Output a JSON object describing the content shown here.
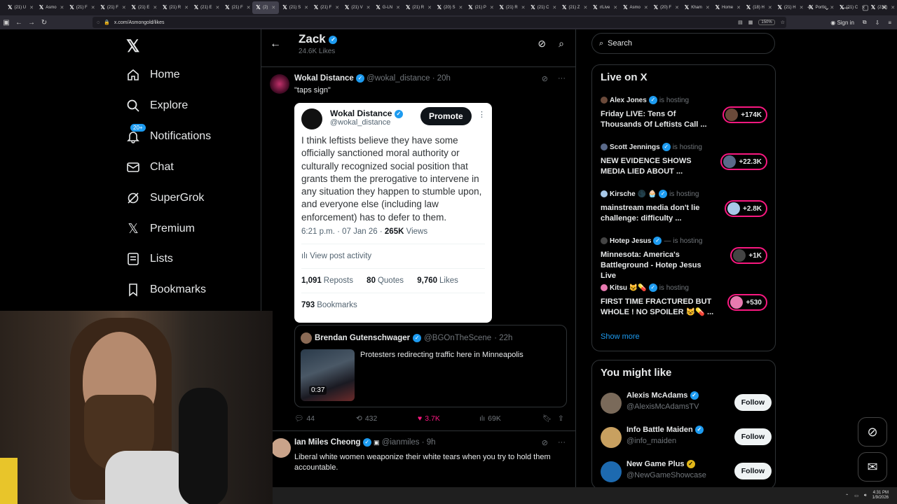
{
  "browser": {
    "tabs": [
      {
        "label": "(21) U",
        "active": false
      },
      {
        "label": "Asmo",
        "active": false
      },
      {
        "label": "(21) F",
        "active": false
      },
      {
        "label": "(21) F",
        "active": false
      },
      {
        "label": "(21) E",
        "active": false
      },
      {
        "label": "(21) R",
        "active": false
      },
      {
        "label": "(21) E",
        "active": false
      },
      {
        "label": "(21) F",
        "active": false
      },
      {
        "label": "(2)",
        "active": true
      },
      {
        "label": "(21) S",
        "active": false
      },
      {
        "label": "(21) F",
        "active": false
      },
      {
        "label": "(21) V",
        "active": false
      },
      {
        "label": "G-LN",
        "active": false
      },
      {
        "label": "(21) R",
        "active": false
      },
      {
        "label": "(20) S",
        "active": false
      },
      {
        "label": "(21) P",
        "active": false
      },
      {
        "label": "(21) R",
        "active": false
      },
      {
        "label": "(21) C",
        "active": false
      },
      {
        "label": "(21) Z",
        "active": false
      },
      {
        "label": "r/Live",
        "active": false
      },
      {
        "label": "Asmo",
        "active": false
      },
      {
        "label": "(20) F",
        "active": false
      },
      {
        "label": "Kham",
        "active": false
      },
      {
        "label": "Home",
        "active": false
      },
      {
        "label": "(18) H",
        "active": false
      },
      {
        "label": "(21) H",
        "active": false
      },
      {
        "label": "Portlo",
        "active": false
      },
      {
        "label": "(21) C",
        "active": false
      },
      {
        "label": "(233)",
        "active": false
      }
    ],
    "url": "x.com/Asmongold/likes",
    "zoom": "150%",
    "sign_in": "Sign in"
  },
  "sidebar": {
    "items": [
      {
        "label": "Home",
        "icon": "home-icon"
      },
      {
        "label": "Explore",
        "icon": "search-icon"
      },
      {
        "label": "Notifications",
        "icon": "bell-icon",
        "badge": "20+"
      },
      {
        "label": "Chat",
        "icon": "mail-icon"
      },
      {
        "label": "SuperGrok",
        "icon": "grok-icon"
      },
      {
        "label": "Premium",
        "icon": "x-icon"
      },
      {
        "label": "Lists",
        "icon": "list-icon"
      },
      {
        "label": "Bookmarks",
        "icon": "bookmark-icon"
      }
    ]
  },
  "header": {
    "name": "Zack",
    "likes": "24.6K Likes"
  },
  "tweet1": {
    "name": "Wokal Distance",
    "handle": "@wokal_distance",
    "time": "· 20h",
    "text": "\"taps sign\"",
    "card": {
      "name": "Wokal Distance",
      "handle": "@wokal_distance",
      "promote": "Promote",
      "body": "I think leftists believe they have some officially sanctioned moral authority or culturally recognized social position that grants them the prerogative to intervene in any situation they happen to stumble upon, and everyone else (including law enforcement) has to defer to them.",
      "date": "6:21 p.m. · 07 Jan 26 ·",
      "views_count": "265K",
      "views_label": "Views",
      "activity": "View post activity",
      "reposts_count": "1,091",
      "reposts_label": "Reposts",
      "quotes_count": "80",
      "quotes_label": "Quotes",
      "likes_count": "9,760",
      "likes_label": "Likes",
      "bookmarks_count": "793",
      "bookmarks_label": "Bookmarks"
    },
    "quote": {
      "name": "Brendan Gutenschwager",
      "handle": "@BGOnTheScene",
      "time": "· 22h",
      "text": "Protesters redirecting traffic here in Minneapolis",
      "duration": "0:37"
    },
    "actions": {
      "replies": "44",
      "reposts": "432",
      "likes": "3.7K",
      "views": "69K"
    }
  },
  "tweet2": {
    "name": "Ian Miles Cheong",
    "handle": "@ianmiles",
    "time": "· 9h",
    "text": "Liberal white women weaponize their white tears when you try to hold them accountable."
  },
  "right": {
    "search_placeholder": "Search",
    "live_title": "Live on X",
    "live": [
      {
        "host": "Alex Jones",
        "suffix": "is hosting",
        "title": "Friday LIVE: Tens Of Thousands Of Leftists Call ...",
        "count": "+174K",
        "color": "#6b4a3a"
      },
      {
        "host": "Scott Jennings",
        "suffix": "is hosting",
        "title": "NEW EVIDENCE SHOWS MEDIA LIED ABOUT ...",
        "count": "+22.3K",
        "color": "#5a6a8a"
      },
      {
        "host": "Kirsche 🌑 🧁",
        "suffix": "is hosting",
        "title": "mainstream media don't lie challenge: difficulty ...",
        "count": "+2.8K",
        "color": "#a8c8e8"
      },
      {
        "host": "Hotep Jesus",
        "suffix": "— is hosting",
        "title": "Minnesota: America's Battleground - Hotep Jesus Live",
        "count": "+1K",
        "color": "#444"
      },
      {
        "host": "Kitsu 😺💊",
        "suffix": "is hosting",
        "title": "FIRST TIME FRACTURED BUT WHOLE ! NO SPOILER 😺💊 ...",
        "count": "+530",
        "color": "#e87ab0"
      }
    ],
    "show_more": "Show more",
    "suggest_title": "You might like",
    "suggestions": [
      {
        "name": "Alexis McAdams",
        "handle": "@AlexisMcAdamsTV",
        "follow": "Follow",
        "color": "#7a6a5a"
      },
      {
        "name": "Info Battle Maiden",
        "handle": "@info_maiden",
        "follow": "Follow",
        "color": "#c8a060"
      },
      {
        "name": "New Game Plus",
        "handle": "@NewGameShowcase",
        "follow": "Follow",
        "color": "#1d6ab0"
      }
    ]
  },
  "taskbar": {
    "time": "4:31 PM",
    "date": "1/9/2026"
  }
}
